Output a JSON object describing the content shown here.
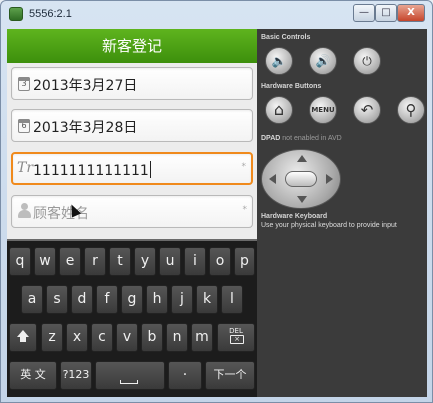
{
  "window": {
    "title": "5556:2.1",
    "min_label": "—",
    "max_label": "□",
    "close_label": "X"
  },
  "app": {
    "title": "新客登记",
    "fields": [
      {
        "value": "2013年3月27日",
        "icon_text": "3"
      },
      {
        "value": "2013年3月28日",
        "icon_text": "6"
      },
      {
        "value": "1111111111111",
        "icon_text": "Tr"
      },
      {
        "placeholder": "顾客姓名"
      }
    ],
    "required_mark": "*"
  },
  "keyboard": {
    "row1": [
      "q",
      "w",
      "e",
      "r",
      "t",
      "y",
      "u",
      "i",
      "o",
      "p"
    ],
    "row2": [
      "a",
      "s",
      "d",
      "f",
      "g",
      "h",
      "j",
      "k",
      "l"
    ],
    "row3": [
      "z",
      "x",
      "c",
      "v",
      "b",
      "n",
      "m"
    ],
    "del_label": "DEL",
    "del_mark": "×",
    "lang_label": "英 文",
    "symbols_label": "?123",
    "dot_label": "·",
    "next_label": "下一个"
  },
  "controls": {
    "basic_label": "Basic Controls",
    "hardware_label": "Hardware Buttons",
    "dpad_label": "DPAD",
    "dpad_note": "not enabled in AVD",
    "keyboard_label": "Hardware Keyboard",
    "keyboard_note": "Use your physical keyboard to provide input",
    "menu_label": "MENU",
    "vol_down_icon": "🔈",
    "vol_up_icon": "🔊",
    "power_icon": "⏻",
    "home_icon": "⌂",
    "back_icon": "↶",
    "search_icon": "⚲"
  }
}
